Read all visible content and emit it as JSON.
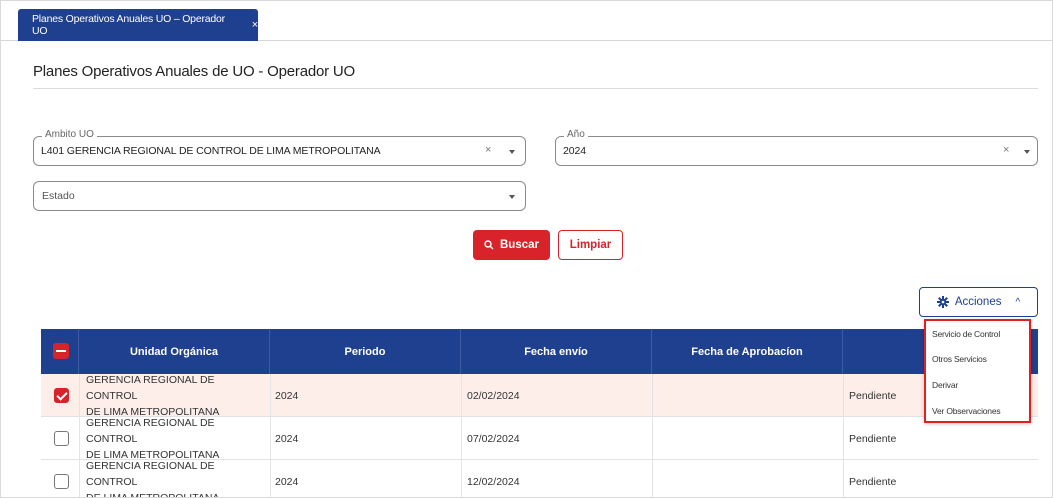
{
  "tab": {
    "label": "Planes Operativos Anuales UO – Operador UO",
    "close": "×"
  },
  "page": {
    "title": "Planes Operativos Anuales de UO - Operador UO"
  },
  "filters": {
    "ambito": {
      "label": "Ambito UO",
      "value": "L401 GERENCIA REGIONAL DE CONTROL DE LIMA METROPOLITANA",
      "clear": "×"
    },
    "anio": {
      "label": "Año",
      "value": "2024",
      "clear": "×"
    },
    "estado": {
      "placeholder": "Estado"
    }
  },
  "buttons": {
    "search": "Buscar",
    "clear": "Limpiar",
    "actions": "Acciones"
  },
  "actions_menu": [
    "Servicio de Control",
    "Otros Servicios",
    "Derivar",
    "Ver Observaciones"
  ],
  "table": {
    "columns": [
      "Unidad Orgánica",
      "Periodo",
      "Fecha envío",
      "Fecha de Aprobacíon"
    ],
    "rows": [
      {
        "org_line1": "GERENCIA REGIONAL DE CONTROL",
        "org_line2": "DE LIMA METROPOLITANA",
        "periodo": "2024",
        "fecha_envio": "02/02/2024",
        "estado": "Pendiente",
        "checked": true
      },
      {
        "org_line1": "GERENCIA REGIONAL DE CONTROL",
        "org_line2": "DE LIMA METROPOLITANA",
        "periodo": "2024",
        "fecha_envio": "07/02/2024",
        "estado": "Pendiente",
        "checked": false
      },
      {
        "org_line1": "GERENCIA REGIONAL DE CONTROL",
        "org_line2": "DE LIMA METROPOLITANA",
        "periodo": "2024",
        "fecha_envio": "12/02/2024",
        "estado": "Pendiente",
        "checked": false
      }
    ]
  },
  "colors": {
    "primary": "#1f3f8f",
    "accent": "#d8232a"
  },
  "icons": {
    "search": "search-icon",
    "actions": "gear-icon",
    "caret": "chevron-up-icon"
  }
}
